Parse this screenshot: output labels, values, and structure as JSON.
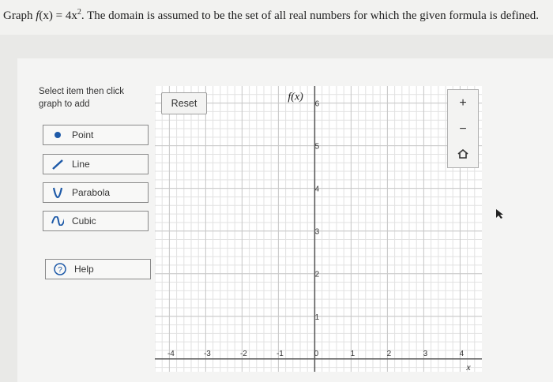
{
  "question": {
    "prefix": "Graph ",
    "fn": "f",
    "arg": "(x) = 4x",
    "exp": "2",
    "suffix": ". The domain is assumed to be the set of all real numbers for which the given formula is defined."
  },
  "instructions": "Select item then click graph to add",
  "tools": [
    {
      "label": "Point",
      "icon": "dot-icon"
    },
    {
      "label": "Line",
      "icon": "line-icon"
    },
    {
      "label": "Parabola",
      "icon": "parabola-icon"
    },
    {
      "label": "Cubic",
      "icon": "cubic-icon"
    }
  ],
  "help": {
    "label": "Help",
    "icon": "help-icon",
    "glyph": "?"
  },
  "graph": {
    "reset_label": "Reset",
    "y_axis_label": "f(x)",
    "x_axis_label": "x",
    "x_ticks": [
      "-4",
      "-3",
      "-2",
      "-1",
      "0",
      "1",
      "2",
      "3",
      "4"
    ],
    "y_ticks": [
      "1",
      "2",
      "3",
      "4",
      "5",
      "6"
    ],
    "x_range": [
      -4.4,
      4.6
    ],
    "y_range": [
      -0.3,
      6.4
    ]
  },
  "zoom": {
    "zoom_in": "+",
    "zoom_out": "−"
  },
  "colors": {
    "accent": "#1e5aa8",
    "grid": "#c8c8c8",
    "axis": "#555555"
  }
}
